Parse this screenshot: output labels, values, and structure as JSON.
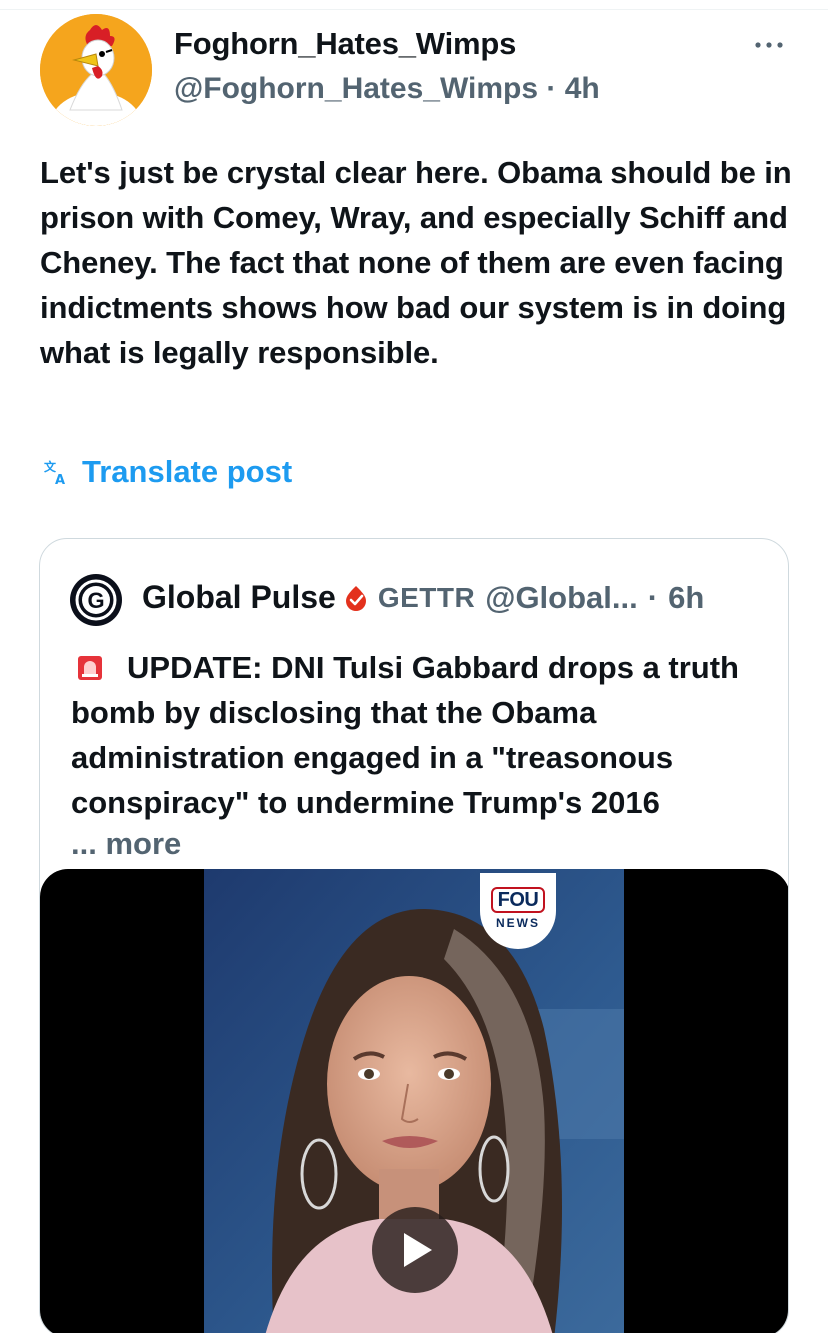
{
  "post": {
    "display_name": "Foghorn_Hates_Wimps",
    "handle": "@Foghorn_Hates_Wimps",
    "separator": "·",
    "time": "4h",
    "more_icon": "more-horizontal-icon",
    "text": "Let's just be crystal clear here. Obama should be in prison with Comey, Wray, and especially Schiff and Cheney. The fact that none of them are even facing indictments shows how bad our system is in doing what is legally responsible.",
    "translate_label": "Translate post",
    "translate_icon": "translate-icon"
  },
  "quote": {
    "display_name": "Global Pulse",
    "badge_icon": "gettr-verified-badge-icon",
    "platform": "GETTR",
    "handle": "@Global...",
    "separator": "·",
    "time": "6h",
    "emoji_icon": "siren-emoji-icon",
    "text": "UPDATE: DNI Tulsi Gabbard drops a truth bomb by disclosing that the Obama administration engaged in a \"treasonous conspiracy\" to undermine Trump's 2016",
    "more_label": "... more",
    "video": {
      "logo_top": "FOU",
      "logo_bottom": "NEWS",
      "play_icon": "play-icon"
    }
  },
  "colors": {
    "link_blue": "#1d9bf0",
    "secondary_text": "#536471",
    "border": "#cfd9de",
    "gettr_red": "#e3311d"
  }
}
